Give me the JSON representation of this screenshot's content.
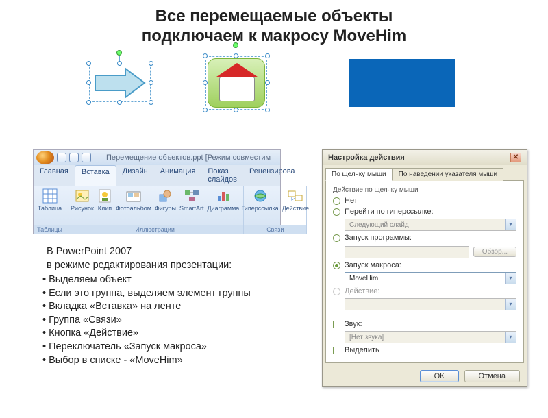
{
  "title_line1": "Все перемещаемые объекты",
  "title_line2": "подключаем к макросу MoveHim",
  "ribbon": {
    "doc_title": "Перемещение объектов.ppt [Режим совместим",
    "tabs": [
      "Главная",
      "Вставка",
      "Дизайн",
      "Анимация",
      "Показ слайдов",
      "Рецензирова"
    ],
    "active_tab": "Вставка",
    "groups": {
      "tables": {
        "label": "Таблицы",
        "items": [
          "Таблица"
        ]
      },
      "illustrations": {
        "label": "Иллюстрации",
        "items": [
          "Рисунок",
          "Клип",
          "Фотоальбом",
          "Фигуры",
          "SmartArt",
          "Диаграмма"
        ]
      },
      "links": {
        "label": "Связи",
        "items": [
          "Гиперссылка",
          "Действие"
        ]
      }
    }
  },
  "dialog": {
    "title": "Настройка действия",
    "tab_click": "По щелчку мыши",
    "tab_hover": "По наведении указателя мыши",
    "group_label": "Действие по щелчку мыши",
    "opt_none": "Нет",
    "opt_hyperlink": "Перейти по гиперссылке:",
    "hyperlink_value": "Следующий слайд",
    "opt_run_prog": "Запуск программы:",
    "browse": "Обзор...",
    "opt_run_macro": "Запуск макроса:",
    "macro_value": "MoveHim",
    "opt_object_action": "Действие:",
    "chk_sound": "Звук:",
    "sound_value": "[Нет звука]",
    "chk_highlight": "Выделить",
    "ok": "ОК",
    "cancel": "Отмена"
  },
  "instructions": {
    "hdr1": "  В PowerPoint 2007",
    "hdr2": "  в режиме редактирования презентации:",
    "bullets": [
      "Выделяем объект",
      "Если это группа, выделяем элемент группы",
      "Вкладка «Вставка» на ленте",
      "Группа «Связи»",
      "Кнопка «Действие»",
      "Переключатель «Запуск макроса»",
      "Выбор в списке - «MoveHim»"
    ]
  }
}
